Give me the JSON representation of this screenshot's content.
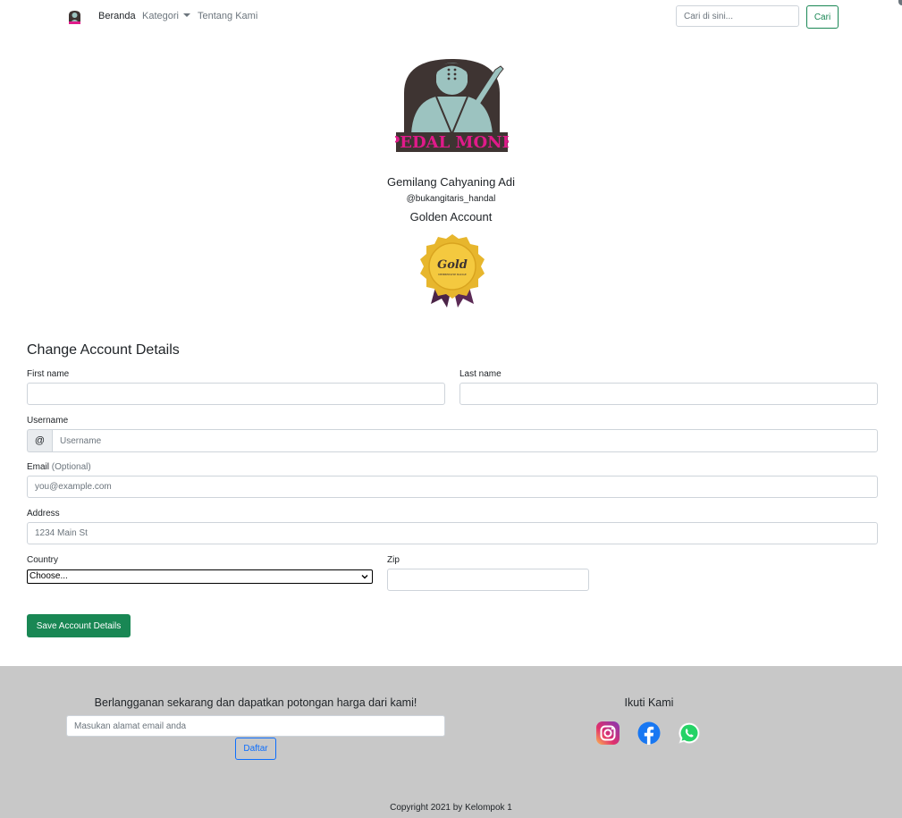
{
  "nav": {
    "logo_icon": "pedal-monk-logo-icon",
    "items": [
      {
        "label": "Beranda"
      },
      {
        "label": "Kategori"
      },
      {
        "label": "Tentang Kami"
      }
    ],
    "search": {
      "placeholder": "Cari di sini...",
      "button_label": "Cari"
    }
  },
  "profile": {
    "logo_text": "PEDAL MONK",
    "name": "Gemilang Cahyaning Adi",
    "handle": "@bukangitaris_handal",
    "tier": "Golden Account",
    "badge_text": "Gold",
    "badge_subtext": "MEMBERSHIP BADGE"
  },
  "form": {
    "title": "Change Account Details",
    "first_name": {
      "label": "First name",
      "value": ""
    },
    "last_name": {
      "label": "Last name",
      "value": ""
    },
    "username": {
      "label": "Username",
      "prefix": "@",
      "placeholder": "Username"
    },
    "email": {
      "label": "Email",
      "optional": "(Optional)",
      "placeholder": "you@example.com"
    },
    "address": {
      "label": "Address",
      "placeholder": "1234 Main St"
    },
    "country": {
      "label": "Country",
      "selected": "Choose..."
    },
    "zip": {
      "label": "Zip",
      "value": ""
    },
    "save_label": "Save Account Details"
  },
  "footer": {
    "subscribe_title": "Berlangganan sekarang dan dapatkan potongan harga dari kami!",
    "subscribe_placeholder": "Masukan alamat email anda",
    "subscribe_button": "Daftar",
    "follow_title": "Ikuti Kami",
    "socials": [
      "instagram-icon",
      "facebook-icon",
      "whatsapp-icon"
    ],
    "copyright": "Copyright 2021 by Kelompok 1"
  },
  "colors": {
    "primary_green": "#198754",
    "primary_blue": "#0d6efd",
    "footer_bg": "#c8c8c8",
    "logo_brown": "#3e3432",
    "logo_teal": "#9cc3c0",
    "logo_magenta": "#e01a8a"
  }
}
